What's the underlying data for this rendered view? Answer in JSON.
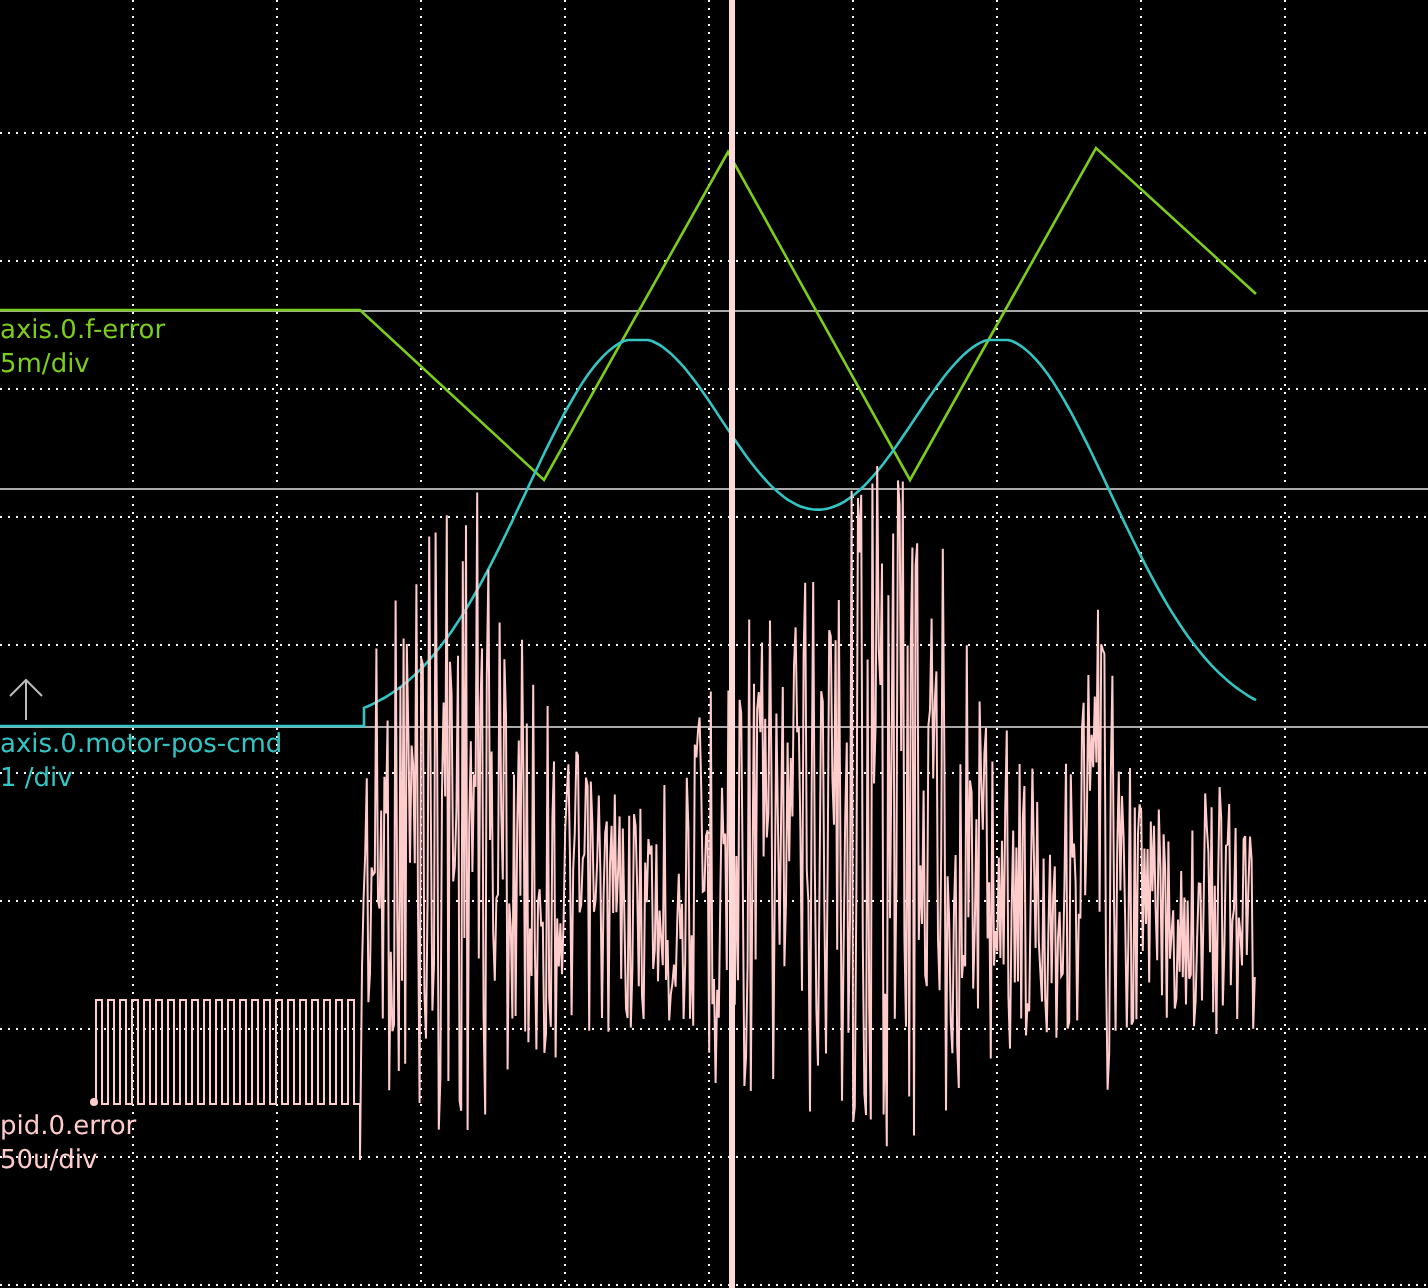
{
  "channels": [
    {
      "name": "axis.0.f-error",
      "scale": "5m/div",
      "color": "#7ccd1c",
      "kind": "ramp"
    },
    {
      "name": "axis.0.motor-pos-cmd",
      "scale": "1 /div",
      "color": "#33c4c4",
      "kind": "smooth"
    },
    {
      "name": "pid.0.error",
      "scale": "50u/div",
      "color": "#ffcccc",
      "kind": "noise"
    }
  ]
}
